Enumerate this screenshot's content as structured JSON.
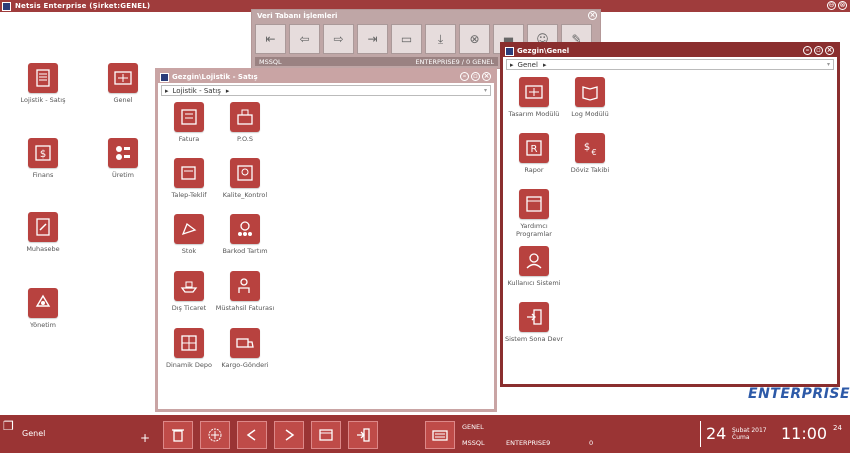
{
  "app": {
    "title": "Netsis Enterprise (Şirket:GENEL)",
    "btn_min": "⊖",
    "btn_close": "⊗"
  },
  "desktop": {
    "icons": [
      {
        "label": "Lojistik - Satış"
      },
      {
        "label": "Genel"
      },
      {
        "label": "Finans"
      },
      {
        "label": "Üretim"
      },
      {
        "label": "Muhasebe"
      },
      {
        "label": "Yönetim"
      }
    ]
  },
  "db_toolbar": {
    "title": "Veri Tabanı İşlemleri",
    "status_left": "MSSQL",
    "status_right": "ENTERPRISE9 / 0 GENEL"
  },
  "lojistik_window": {
    "title": "Gezgin\\Lojistik - Satış",
    "crumb": "Lojistik - Satış",
    "icons": [
      {
        "label": "Fatura"
      },
      {
        "label": "P.O.S"
      },
      {
        "label": "Talep-Teklif"
      },
      {
        "label": "Kalite_Kontrol"
      },
      {
        "label": "Stok"
      },
      {
        "label": "Barkod Tartım"
      },
      {
        "label": "Dış Ticaret"
      },
      {
        "label": "Müstahsil Faturası"
      },
      {
        "label": "Dinamik Depo"
      },
      {
        "label": "Kargo-Gönderi"
      }
    ]
  },
  "genel_window": {
    "title": "Gezgin\\Genel",
    "crumb": "Genel",
    "icons": [
      {
        "label": "Tasarım Modülü"
      },
      {
        "label": "Log Modülü"
      },
      {
        "label": "Rapor"
      },
      {
        "label": "Döviz Takibi"
      },
      {
        "label": "Yardımcı Programlar"
      },
      {
        "label": "Kullanıcı Sistemi"
      },
      {
        "label": "Sistem Sona Devr"
      }
    ]
  },
  "brand": {
    "text": "ENTERPRISE"
  },
  "taskbar": {
    "current": "Genel",
    "plus": "+",
    "company": "GENEL",
    "db_type": "MSSQL",
    "db_name": "ENTERPRISE9",
    "db_num": "0",
    "day": "24",
    "month_year": "Şubat 2017",
    "weekday": "Cuma",
    "time": "11:00",
    "seconds": "24"
  },
  "colors": {
    "accent": "#b8423f",
    "taskbar": "#9a3434",
    "window_border": "#c9a4a4"
  }
}
